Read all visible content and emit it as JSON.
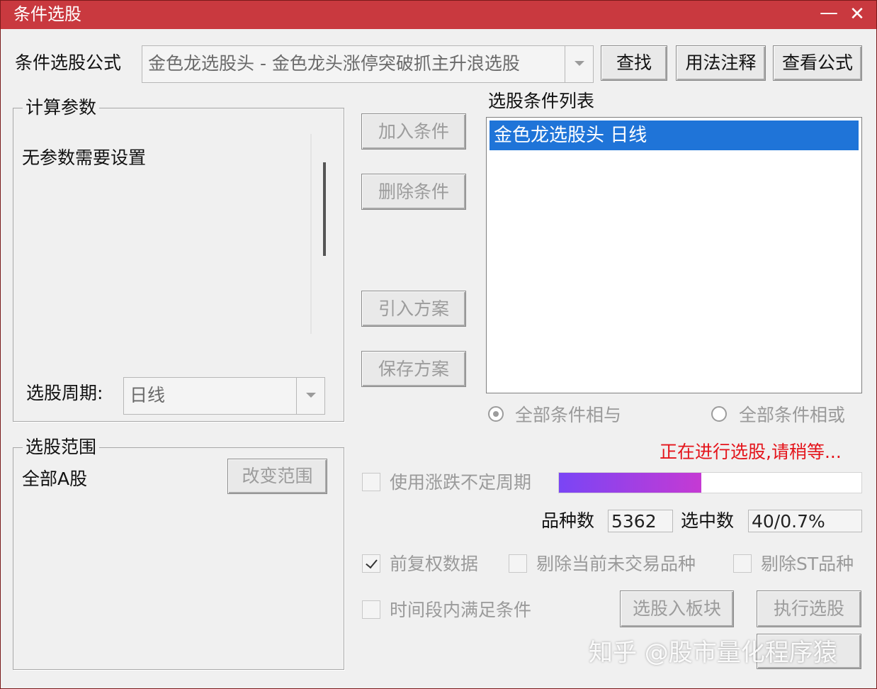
{
  "window": {
    "title": "条件选股",
    "minimize_glyph": "—",
    "close_glyph": "✕"
  },
  "formula": {
    "label": "条件选股公式",
    "selected": "金色龙选股头  -  金色龙头涨停突破抓主升浪选股",
    "find_button": "查找",
    "usage_button": "用法注释",
    "view_button": "查看公式"
  },
  "params": {
    "group_title": "计算参数",
    "message": "无参数需要设置",
    "period_label": "选股周期:",
    "period_value": "日线"
  },
  "range": {
    "group_title": "选股范围",
    "value": "全部A股",
    "change_button": "改变范围"
  },
  "actions": {
    "add_condition": "加入条件",
    "delete_condition": "删除条件",
    "import_plan": "引入方案",
    "save_plan": "保存方案"
  },
  "conditions": {
    "list_title": "选股条件列表",
    "items": [
      "金色龙选股头  日线"
    ]
  },
  "logic": {
    "and_label": "全部条件相与",
    "or_label": "全部条件相或",
    "selected": "and"
  },
  "status": {
    "text": "正在进行选股,请稍等...",
    "color": "#e4141b"
  },
  "options": {
    "uncertain_period": {
      "label": "使用涨跌不定周期",
      "checked": false
    },
    "forward_adjust": {
      "label": "前复权数据",
      "checked": true
    },
    "remove_untraded": {
      "label": "剔除当前未交易品种",
      "checked": false
    },
    "remove_st": {
      "label": "剔除ST品种",
      "checked": false
    },
    "period_satisfy": {
      "label": "时间段内满足条件",
      "checked": false
    }
  },
  "progress": {
    "fraction": 0.47,
    "color_start": "#7a45f5",
    "color_end": "#c53ad3"
  },
  "stats": {
    "count_label": "品种数",
    "count_value": "5362",
    "selected_label": "选中数",
    "selected_value": "40/0.7%"
  },
  "buttons": {
    "to_block": "选股入板块",
    "execute": "执行选股"
  },
  "watermark": "知乎 @股市量化程序猿",
  "colors": {
    "titlebar": "#c9393f",
    "selection": "#1f74d8"
  }
}
